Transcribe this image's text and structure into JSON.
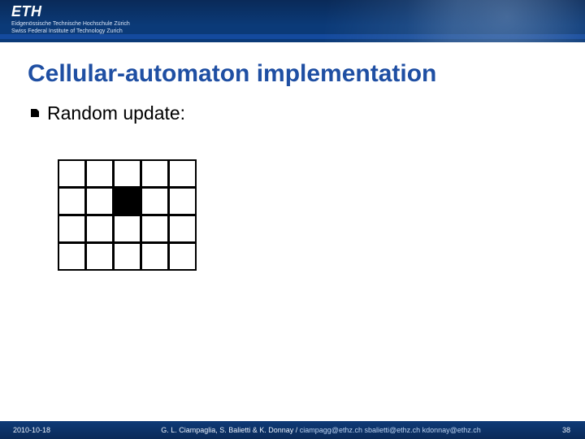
{
  "header": {
    "logo": "ETH",
    "subline1": "Eidgenössische Technische Hochschule Zürich",
    "subline2": "Swiss Federal Institute of Technology Zurich"
  },
  "slide": {
    "title": "Cellular-automaton implementation",
    "bullet": "Random update:"
  },
  "grid": {
    "rows": 4,
    "cols": 5,
    "filled": [
      [
        1,
        2
      ]
    ]
  },
  "footer": {
    "date": "2010-10-18",
    "authors": "G. L. Ciampaglia, S. Balietti & K. Donnay /",
    "emails": "ciampagg@ethz.ch  sbalietti@ethz.ch  kdonnay@ethz.ch",
    "page": "38"
  }
}
